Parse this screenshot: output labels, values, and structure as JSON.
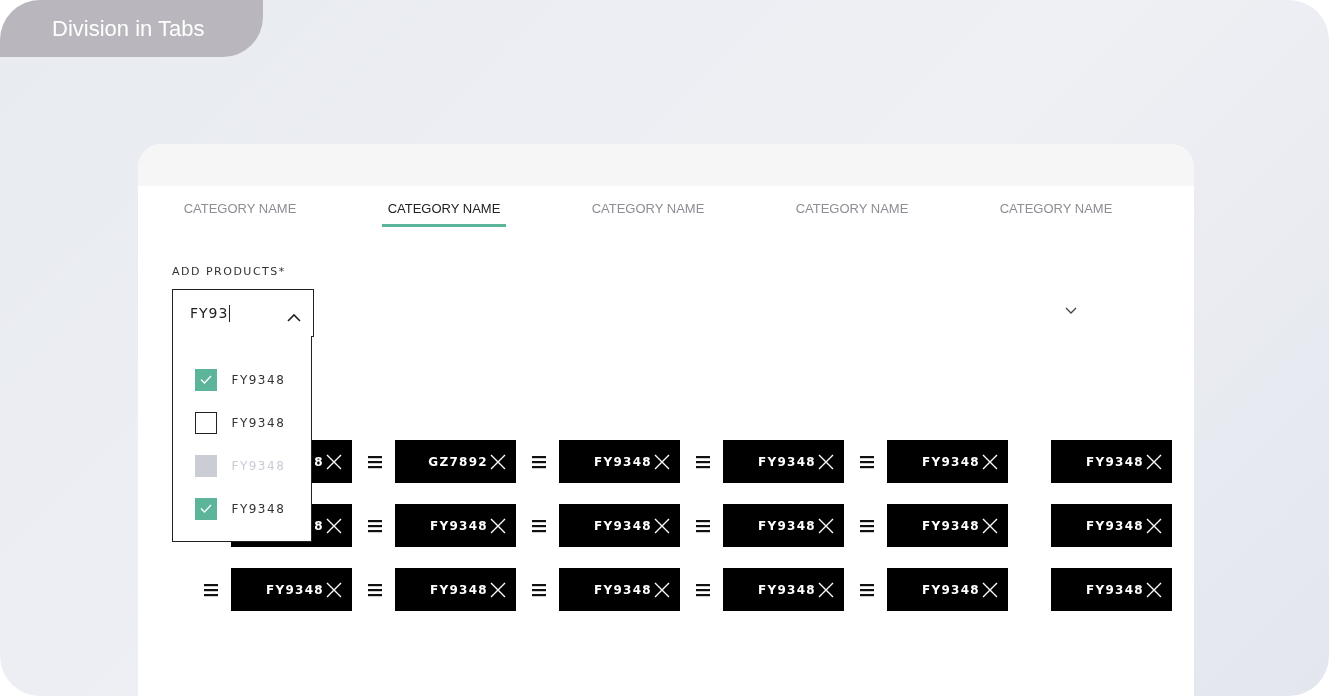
{
  "badge": {
    "title": "Division in Tabs"
  },
  "tabs": [
    {
      "label": "CATEGORY NAME",
      "selected": false
    },
    {
      "label": "CATEGORY NAME",
      "selected": true
    },
    {
      "label": "CATEGORY NAME",
      "selected": false
    },
    {
      "label": "CATEGORY NAME",
      "selected": false
    },
    {
      "label": "CATEGORY NAME",
      "selected": false
    }
  ],
  "field": {
    "label": "ADD PRODUCTS*",
    "value": "FY93",
    "expanded": true
  },
  "options": [
    {
      "label": "FY9348",
      "checked": true,
      "disabled": false
    },
    {
      "label": "FY9348",
      "checked": false,
      "disabled": false
    },
    {
      "label": "FY9348",
      "checked": false,
      "disabled": true
    },
    {
      "label": "FY9348",
      "checked": true,
      "disabled": false
    }
  ],
  "chip_rows": [
    {
      "chips": [
        {
          "label": "8",
          "handle": false
        },
        {
          "label": "GZ7892",
          "handle": true
        },
        {
          "label": "FY9348",
          "handle": true
        },
        {
          "label": "FY9348",
          "handle": true
        },
        {
          "label": "FY9348",
          "handle": true
        },
        {
          "label": "FY9348",
          "handle": false
        }
      ]
    },
    {
      "chips": [
        {
          "label": "8",
          "handle": false
        },
        {
          "label": "FY9348",
          "handle": true
        },
        {
          "label": "FY9348",
          "handle": true
        },
        {
          "label": "FY9348",
          "handle": true
        },
        {
          "label": "FY9348",
          "handle": true
        },
        {
          "label": "FY9348",
          "handle": false
        }
      ]
    },
    {
      "chips": [
        {
          "label": "FY9348",
          "handle": true
        },
        {
          "label": "FY9348",
          "handle": true
        },
        {
          "label": "FY9348",
          "handle": true
        },
        {
          "label": "FY9348",
          "handle": true
        },
        {
          "label": "FY9348",
          "handle": true
        },
        {
          "label": "FY9348",
          "handle": false
        }
      ]
    }
  ]
}
